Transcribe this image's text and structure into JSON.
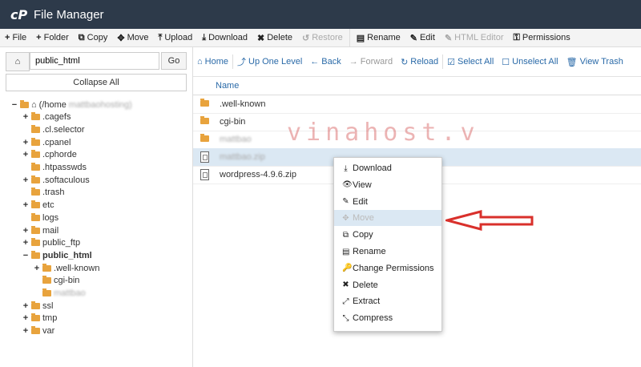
{
  "header": {
    "logo": "cP",
    "title": "File Manager"
  },
  "toolbar": [
    {
      "icon": "+",
      "label": "File",
      "disabled": false
    },
    {
      "icon": "+",
      "label": "Folder",
      "disabled": false
    },
    {
      "icon": "⧉",
      "label": "Copy",
      "disabled": false
    },
    {
      "icon": "✥",
      "label": "Move",
      "disabled": false
    },
    {
      "icon": "⤒",
      "label": "Upload",
      "disabled": false
    },
    {
      "icon": "⤓",
      "label": "Download",
      "disabled": false
    },
    {
      "icon": "✖",
      "label": "Delete",
      "disabled": false
    },
    {
      "icon": "↺",
      "label": "Restore",
      "disabled": true
    },
    {
      "icon": "▤",
      "label": "Rename",
      "disabled": false
    },
    {
      "icon": "✎",
      "label": "Edit",
      "disabled": false
    },
    {
      "icon": "✎",
      "label": "HTML Editor",
      "disabled": true
    },
    {
      "icon": "⚿",
      "label": "Permissions",
      "disabled": false
    }
  ],
  "sidebar": {
    "path_value": "public_html",
    "go_label": "Go",
    "collapse_label": "Collapse All",
    "tree": [
      {
        "label": "(/home",
        "tail": "mattbaohosting)",
        "level": 0,
        "pm": "−",
        "type": "home"
      },
      {
        "label": ".cagefs",
        "level": 1,
        "pm": "+",
        "type": "folder"
      },
      {
        "label": ".cl.selector",
        "level": 1,
        "pm": "",
        "type": "folder"
      },
      {
        "label": ".cpanel",
        "level": 1,
        "pm": "+",
        "type": "folder"
      },
      {
        "label": ".cphorde",
        "level": 1,
        "pm": "+",
        "type": "folder"
      },
      {
        "label": ".htpasswds",
        "level": 1,
        "pm": "",
        "type": "folder"
      },
      {
        "label": ".softaculous",
        "level": 1,
        "pm": "+",
        "type": "folder"
      },
      {
        "label": ".trash",
        "level": 1,
        "pm": "",
        "type": "folder"
      },
      {
        "label": "etc",
        "level": 1,
        "pm": "+",
        "type": "folder"
      },
      {
        "label": "logs",
        "level": 1,
        "pm": "",
        "type": "folder"
      },
      {
        "label": "mail",
        "level": 1,
        "pm": "+",
        "type": "folder"
      },
      {
        "label": "public_ftp",
        "level": 1,
        "pm": "+",
        "type": "folder"
      },
      {
        "label": "public_html",
        "level": 1,
        "pm": "−",
        "type": "folder",
        "bold": true
      },
      {
        "label": ".well-known",
        "level": 2,
        "pm": "+",
        "type": "folder"
      },
      {
        "label": "cgi-bin",
        "level": 2,
        "pm": "",
        "type": "folder"
      },
      {
        "label": "mattbao",
        "level": 2,
        "pm": "",
        "type": "folder",
        "blur": true
      },
      {
        "label": "ssl",
        "level": 1,
        "pm": "+",
        "type": "folder"
      },
      {
        "label": "tmp",
        "level": 1,
        "pm": "+",
        "type": "folder"
      },
      {
        "label": "var",
        "level": 1,
        "pm": "+",
        "type": "folder"
      }
    ]
  },
  "nav": [
    {
      "icon": "⌂",
      "label": "Home",
      "disabled": false
    },
    {
      "icon": "⤴",
      "label": "Up One Level",
      "disabled": false
    },
    {
      "icon": "←",
      "label": "Back",
      "disabled": false
    },
    {
      "icon": "→",
      "label": "Forward",
      "disabled": true
    },
    {
      "icon": "↻",
      "label": "Reload",
      "disabled": false
    },
    {
      "icon": "☑",
      "label": "Select All",
      "disabled": false
    },
    {
      "icon": "☐",
      "label": "Unselect All",
      "disabled": false
    },
    {
      "icon": "🗑",
      "label": "View Trash",
      "disabled": false
    }
  ],
  "files": {
    "column_name": "Name",
    "rows": [
      {
        "name": ".well-known",
        "type": "folder",
        "selected": false,
        "blur": false
      },
      {
        "name": "cgi-bin",
        "type": "folder",
        "selected": false,
        "blur": false
      },
      {
        "name": "mattbao",
        "type": "folder",
        "selected": false,
        "blur": true
      },
      {
        "name": "mattbao.zip",
        "type": "zip",
        "selected": true,
        "blur": true
      },
      {
        "name": "wordpress-4.9.6.zip",
        "type": "zip",
        "selected": false,
        "blur": false
      }
    ]
  },
  "context_menu": [
    {
      "icon": "⤓",
      "label": "Download",
      "highlight": false
    },
    {
      "icon": "👁",
      "label": "View",
      "highlight": false
    },
    {
      "icon": "✎",
      "label": "Edit",
      "highlight": false
    },
    {
      "icon": "✥",
      "label": "Move",
      "highlight": true
    },
    {
      "icon": "⧉",
      "label": "Copy",
      "highlight": false
    },
    {
      "icon": "▤",
      "label": "Rename",
      "highlight": false
    },
    {
      "icon": "🔑",
      "label": "Change Permissions",
      "highlight": false
    },
    {
      "icon": "✖",
      "label": "Delete",
      "highlight": false
    },
    {
      "icon": "⤢",
      "label": "Extract",
      "highlight": false
    },
    {
      "icon": "⤡",
      "label": "Compress",
      "highlight": false
    }
  ],
  "watermark": "vinahost.v",
  "colors": {
    "header_bg": "#2d3a4a",
    "accent": "#2a6aa8",
    "arrow": "#d9302b",
    "folder": "#e8a33d"
  }
}
